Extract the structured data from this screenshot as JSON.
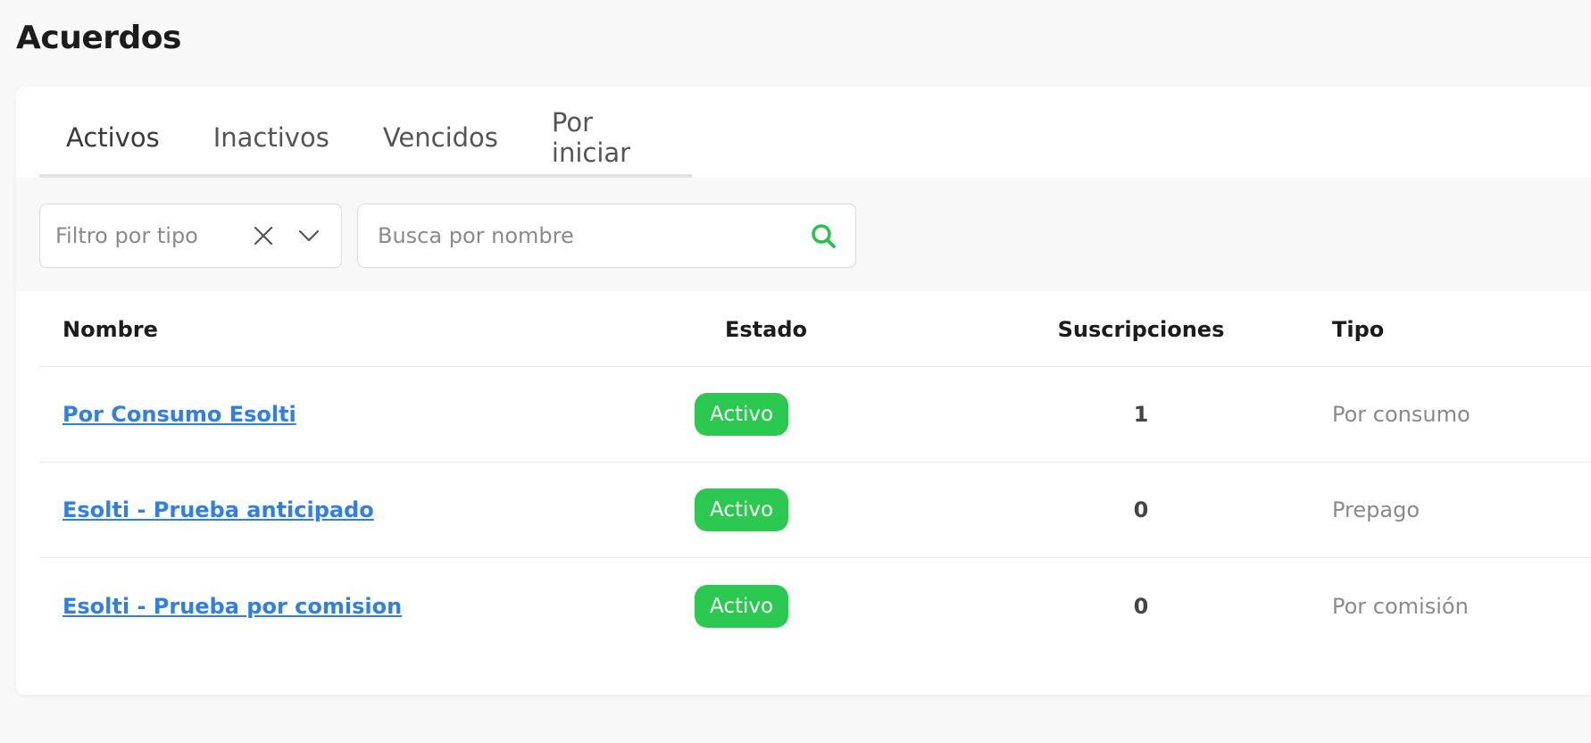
{
  "page": {
    "title": "Acuerdos"
  },
  "tabs": [
    {
      "label": "Activos",
      "active": true
    },
    {
      "label": "Inactivos",
      "active": false
    },
    {
      "label": "Vencidos",
      "active": false
    },
    {
      "label": "Por iniciar",
      "active": false
    }
  ],
  "filters": {
    "type_placeholder": "Filtro por tipo",
    "search_placeholder": "Busca por nombre",
    "search_value": ""
  },
  "table": {
    "headers": {
      "name": "Nombre",
      "state": "Estado",
      "subscriptions": "Suscripciones",
      "type": "Tipo"
    },
    "rows": [
      {
        "name": "Por Consumo Esolti",
        "state": "Activo",
        "subscriptions": "1",
        "type": "Por consumo"
      },
      {
        "name": "Esolti - Prueba anticipado",
        "state": "Activo",
        "subscriptions": "0",
        "type": "Prepago"
      },
      {
        "name": "Esolti - Prueba por comision",
        "state": "Activo",
        "subscriptions": "0",
        "type": "Por comisión"
      }
    ]
  },
  "colors": {
    "accent": "#27c24c",
    "link": "#2f7fe6",
    "badge": "#2bc94f"
  },
  "icons": {
    "clear": "close-icon",
    "dropdown": "chevron-down-icon",
    "search": "search-icon"
  }
}
